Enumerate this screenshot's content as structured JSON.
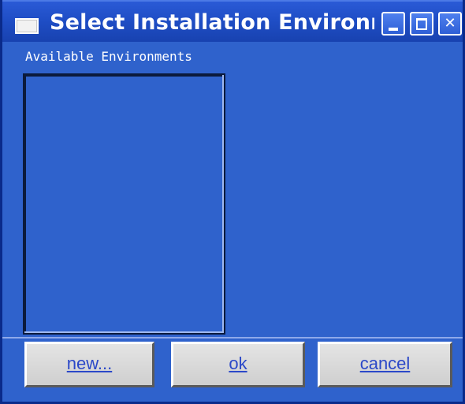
{
  "window": {
    "title": "Select Installation Environm",
    "controls": {
      "minimize": "minimize-icon",
      "maximize": "maximize-icon",
      "close": "close-icon",
      "close_glyph": "✕"
    }
  },
  "environments": {
    "label": "Available Environments",
    "items": []
  },
  "buttons": {
    "new_label": "new...",
    "ok_label": "ok",
    "cancel_label": "cancel"
  },
  "colors": {
    "window_background": "#2f62cc",
    "titlebar": "#1f4ec6",
    "button_text": "#2b48c8",
    "button_face": "#d9d9d9"
  }
}
